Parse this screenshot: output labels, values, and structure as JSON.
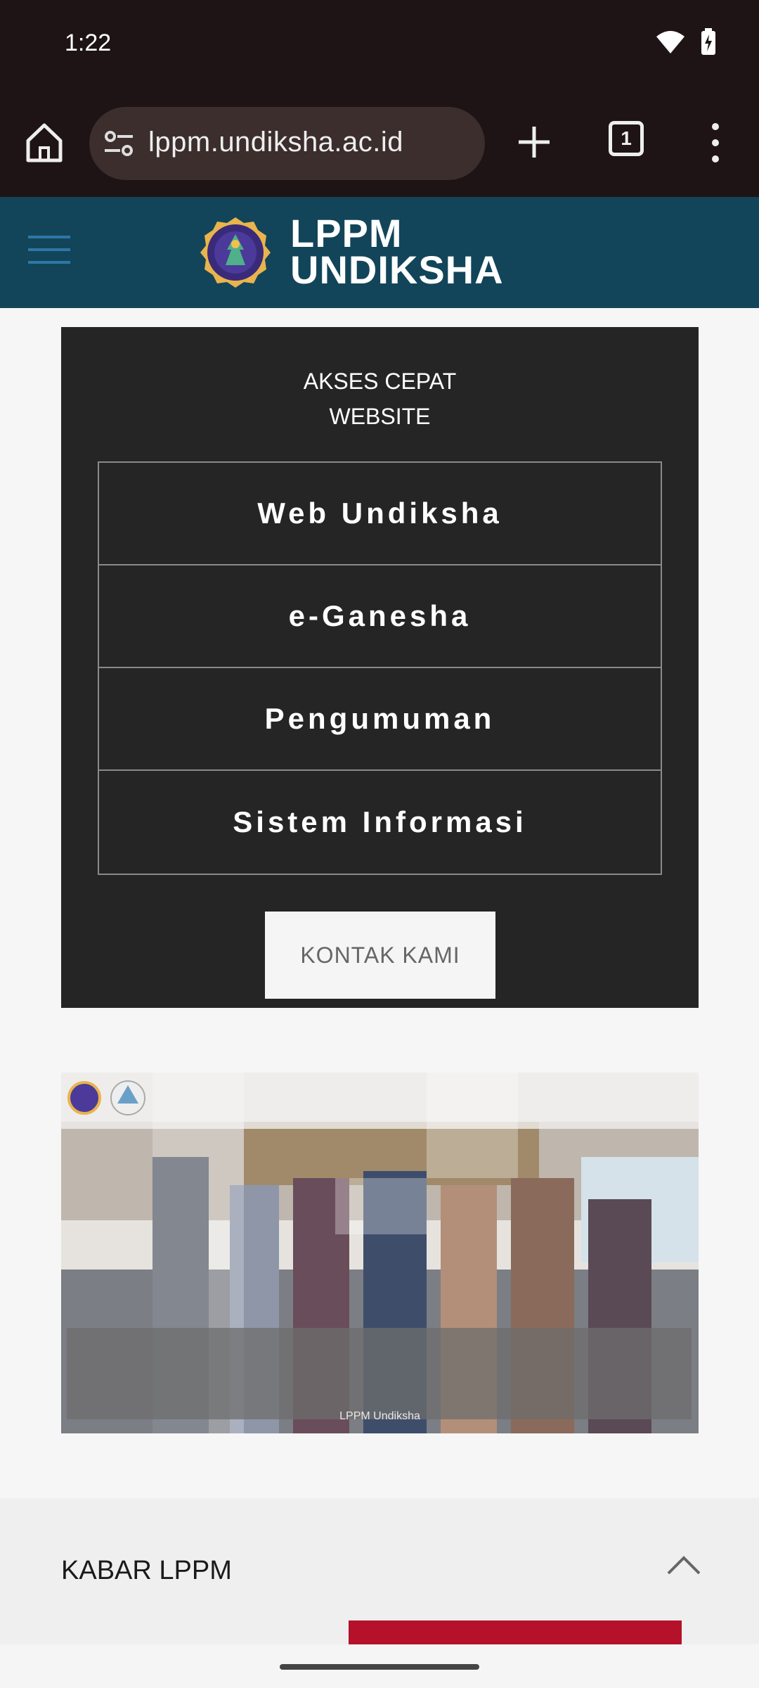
{
  "status_bar": {
    "time": "1:22"
  },
  "browser": {
    "url": "lppm.undiksha.ac.id",
    "tab_count": "1"
  },
  "site": {
    "logo_line1": "LPPM",
    "logo_line2": "UNDIKSHA"
  },
  "quick_access": {
    "title_line1": "AKSES CEPAT",
    "title_line2": "WEBSITE",
    "items": [
      "Web Undiksha",
      "e-Ganesha",
      "Pengumuman",
      "Sistem Informasi"
    ],
    "contact_label": "KONTAK KAMI"
  },
  "video": {
    "caption": "LPPM Undiksha"
  },
  "kabar": {
    "title": "KABAR LPPM"
  },
  "colors": {
    "header": "#124559",
    "panel": "#252525",
    "accent_red": "#b5112a",
    "browser_bg": "#1f1415"
  }
}
